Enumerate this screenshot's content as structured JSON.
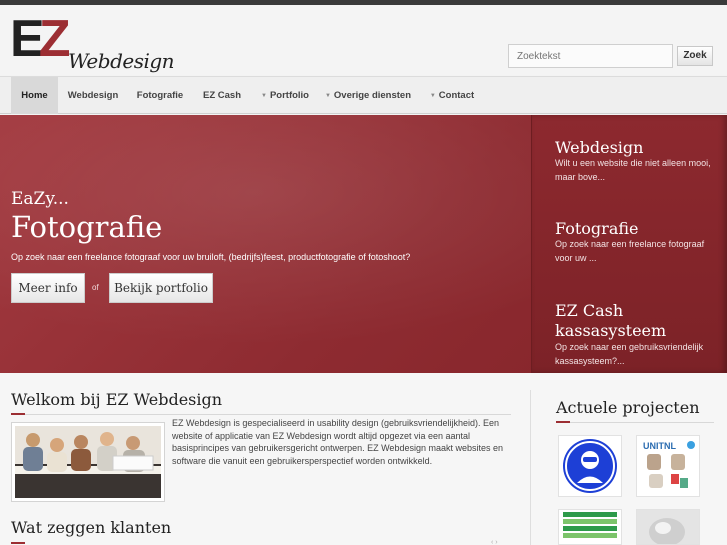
{
  "brand": {
    "logo_mark": "EZ",
    "logo_text": "Webdesign"
  },
  "search": {
    "placeholder": "Zoektekst",
    "button_label": "Zoek"
  },
  "nav": {
    "items": [
      {
        "label": "Home",
        "active": true,
        "dropdown": false
      },
      {
        "label": "Webdesign",
        "active": false,
        "dropdown": false
      },
      {
        "label": "Fotografie",
        "active": false,
        "dropdown": false
      },
      {
        "label": "EZ Cash",
        "active": false,
        "dropdown": false
      },
      {
        "label": "Portfolio",
        "active": false,
        "dropdown": true
      },
      {
        "label": "Overige diensten",
        "active": false,
        "dropdown": true
      },
      {
        "label": "Contact",
        "active": false,
        "dropdown": true
      }
    ]
  },
  "hero": {
    "kicker": "EaZy...",
    "title": "Fotografie",
    "description": "Op zoek naar een freelance fotograaf voor uw bruiloft, (bedrijfs)feest, productfotografie of fotoshoot?",
    "primary_button": "Meer info",
    "or_text": "of",
    "secondary_button": "Bekijk portfolio"
  },
  "hero_sidebar": [
    {
      "title": "Webdesign",
      "text": "Wilt u een website die niet alleen mooi, maar bove..."
    },
    {
      "title": "Fotografie",
      "text": "Op zoek naar een freelance fotograaf voor uw ..."
    },
    {
      "title": "EZ Cash kassasysteem",
      "text": "Op zoek naar een gebruiksvriendelijk kassasysteem?..."
    }
  ],
  "welcome": {
    "title": "Welkom bij EZ Webdesign",
    "text": "EZ Webdesign is gespecialiseerd in usability design (gebruiksvriendelijkheid). Een website of applicatie van EZ Webdesign wordt altijd opgezet via een aantal basisprincipes van gebruikersgericht ontwerpen. EZ Webdesign maakt websites en software die vanuit een gebruikersperspectief worden ontwikkeld."
  },
  "testimonials": {
    "title": "Wat zeggen klanten"
  },
  "projects": {
    "title": "Actuele projecten",
    "thumb_label": "UNITNL"
  },
  "colors": {
    "brand_red": "#9c2e33",
    "hero_red": "#8e2b31",
    "nav_bg": "#efefef"
  }
}
